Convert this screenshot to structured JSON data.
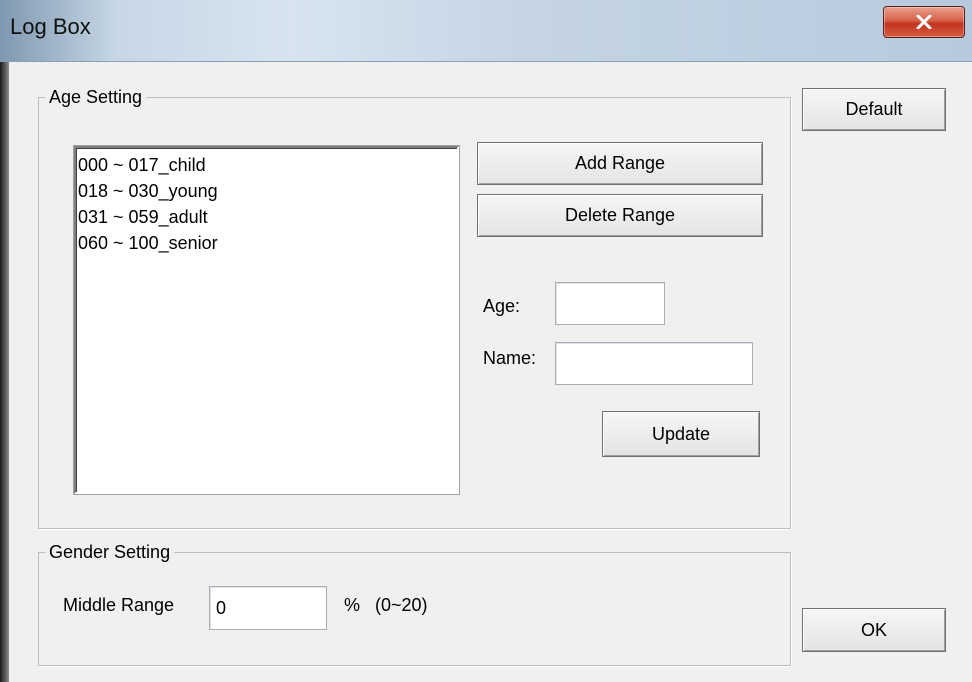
{
  "window": {
    "title": "Log Box",
    "close_icon": "close-x-icon"
  },
  "age_setting": {
    "legend": "Age Setting",
    "ranges": [
      "000 ~ 017_child",
      "018 ~ 030_young",
      "031 ~ 059_adult",
      "060 ~ 100_senior"
    ],
    "add_range_label": "Add Range",
    "delete_range_label": "Delete Range",
    "age_label": "Age:",
    "age_value": "",
    "name_label": "Name:",
    "name_value": "",
    "update_label": "Update"
  },
  "gender_setting": {
    "legend": "Gender Setting",
    "middle_range_label": "Middle Range",
    "middle_range_value": "0",
    "unit_label": "%",
    "range_hint": "(0~20)"
  },
  "buttons": {
    "default_label": "Default",
    "ok_label": "OK"
  },
  "colors": {
    "titlebar": "#c7d7e6",
    "close_button": "#c2351f",
    "dialog_background": "#f0f0f0"
  }
}
